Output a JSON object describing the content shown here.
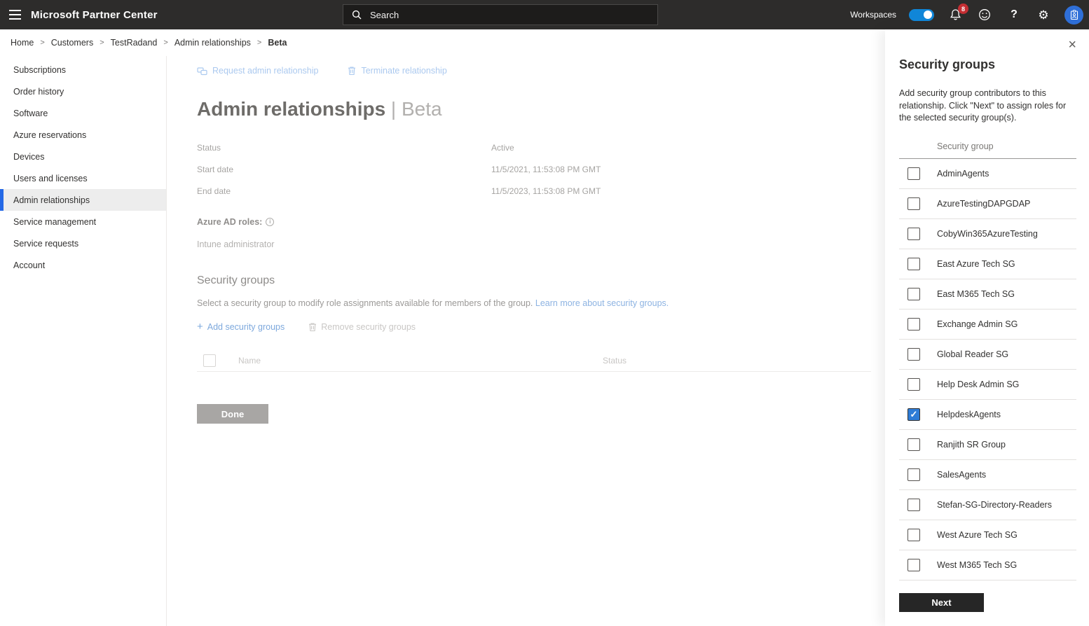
{
  "colors": {
    "topbar_bg": "#2d2c2b",
    "accent_blue": "#1086d8",
    "selected_nav_border": "#2569e6",
    "badge_red": "#c52e33",
    "checked_checkbox": "#2e7cd6",
    "next_button_bg": "#262626",
    "done_button_bg": "#a8a6a4",
    "disabled_link_blue": "#abc9ef"
  },
  "topbar": {
    "app_title": "Microsoft Partner Center",
    "search_placeholder": "Search",
    "workspaces_label": "Workspaces",
    "notification_badge": "8",
    "help_label": "?"
  },
  "breadcrumb": {
    "items": [
      "Home",
      "Customers",
      "TestRadand",
      "Admin relationships",
      "Beta"
    ]
  },
  "sidebar": {
    "items": [
      {
        "label": "Subscriptions",
        "selected": false
      },
      {
        "label": "Order history",
        "selected": false
      },
      {
        "label": "Software",
        "selected": false
      },
      {
        "label": "Azure reservations",
        "selected": false
      },
      {
        "label": "Devices",
        "selected": false
      },
      {
        "label": "Users and licenses",
        "selected": false
      },
      {
        "label": "Admin relationships",
        "selected": true
      },
      {
        "label": "Service management",
        "selected": false
      },
      {
        "label": "Service requests",
        "selected": false
      },
      {
        "label": "Account",
        "selected": false
      }
    ]
  },
  "main": {
    "toolbar": {
      "request_label": "Request admin relationship",
      "terminate_label": "Terminate relationship"
    },
    "title": "Admin relationships",
    "title_separator": " | ",
    "title_suffix": "Beta",
    "details": [
      {
        "label": "Status",
        "value": "Active"
      },
      {
        "label": "Start date",
        "value": "11/5/2021, 11:53:08 PM GMT"
      },
      {
        "label": "End date",
        "value": "11/5/2023, 11:53:08 PM GMT"
      }
    ],
    "azure_ad_roles": {
      "label": "Azure AD roles:",
      "info": "i",
      "value": "Intune administrator"
    },
    "security_groups": {
      "heading": "Security groups",
      "description": "Select a security group to modify role assignments available for members of the group. ",
      "link_text": "Learn more about security groups.",
      "add_label": "Add security groups",
      "remove_label": "Remove security groups",
      "col_name": "Name",
      "col_status": "Status"
    },
    "done_label": "Done"
  },
  "panel": {
    "close_glyph": "×",
    "title": "Security groups",
    "description": "Add security group contributors to this relationship. Click \"Next\" to assign roles for the selected security group(s).",
    "column_header": "Security group",
    "check_glyph": "✓",
    "groups": [
      {
        "name": "AdminAgents",
        "checked": false
      },
      {
        "name": "AzureTestingDAPGDAP",
        "checked": false
      },
      {
        "name": "CobyWin365AzureTesting",
        "checked": false
      },
      {
        "name": "East Azure Tech SG",
        "checked": false
      },
      {
        "name": "East M365 Tech SG",
        "checked": false
      },
      {
        "name": "Exchange Admin SG",
        "checked": false
      },
      {
        "name": "Global Reader SG",
        "checked": false
      },
      {
        "name": "Help Desk Admin SG",
        "checked": false
      },
      {
        "name": "HelpdeskAgents",
        "checked": true
      },
      {
        "name": "Ranjith SR Group",
        "checked": false
      },
      {
        "name": "SalesAgents",
        "checked": false
      },
      {
        "name": "Stefan-SG-Directory-Readers",
        "checked": false
      },
      {
        "name": "West Azure Tech SG",
        "checked": false
      },
      {
        "name": "West M365 Tech SG",
        "checked": false
      }
    ],
    "next_label": "Next"
  }
}
